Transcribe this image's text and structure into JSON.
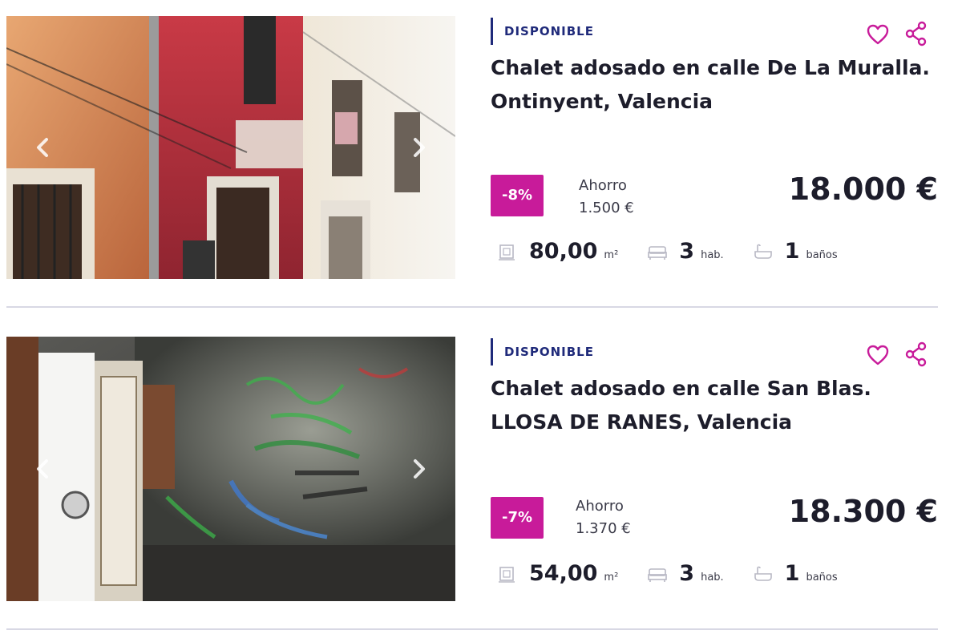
{
  "listings": [
    {
      "status": "DISPONIBLE",
      "title_line1": "Chalet adosado en calle De La Muralla.",
      "title_line2": "Ontinyent, Valencia",
      "discount": "-8%",
      "savings_label": "Ahorro",
      "savings_amount": "1.500 €",
      "price": "18.000 €",
      "area": "80,00",
      "area_unit": "m²",
      "rooms": "3",
      "rooms_unit": "hab.",
      "baths": "1",
      "baths_unit": "baños"
    },
    {
      "status": "DISPONIBLE",
      "title_line1": "Chalet adosado en calle San Blas.",
      "title_line2": "LLOSA DE RANES, Valencia",
      "discount": "-7%",
      "savings_label": "Ahorro",
      "savings_amount": "1.370 €",
      "price": "18.300 €",
      "area": "54,00",
      "area_unit": "m²",
      "rooms": "3",
      "rooms_unit": "hab.",
      "baths": "1",
      "baths_unit": "baños"
    }
  ],
  "icons": {
    "prev": "chevron-left-icon",
    "next": "chevron-right-icon",
    "favorite": "heart-icon",
    "share": "share-icon",
    "area": "area-icon",
    "rooms": "bed-icon",
    "baths": "bathtub-icon"
  },
  "colors": {
    "accent": "#c81b9a",
    "status": "#1f2a7a",
    "text": "#1d1d2b"
  }
}
